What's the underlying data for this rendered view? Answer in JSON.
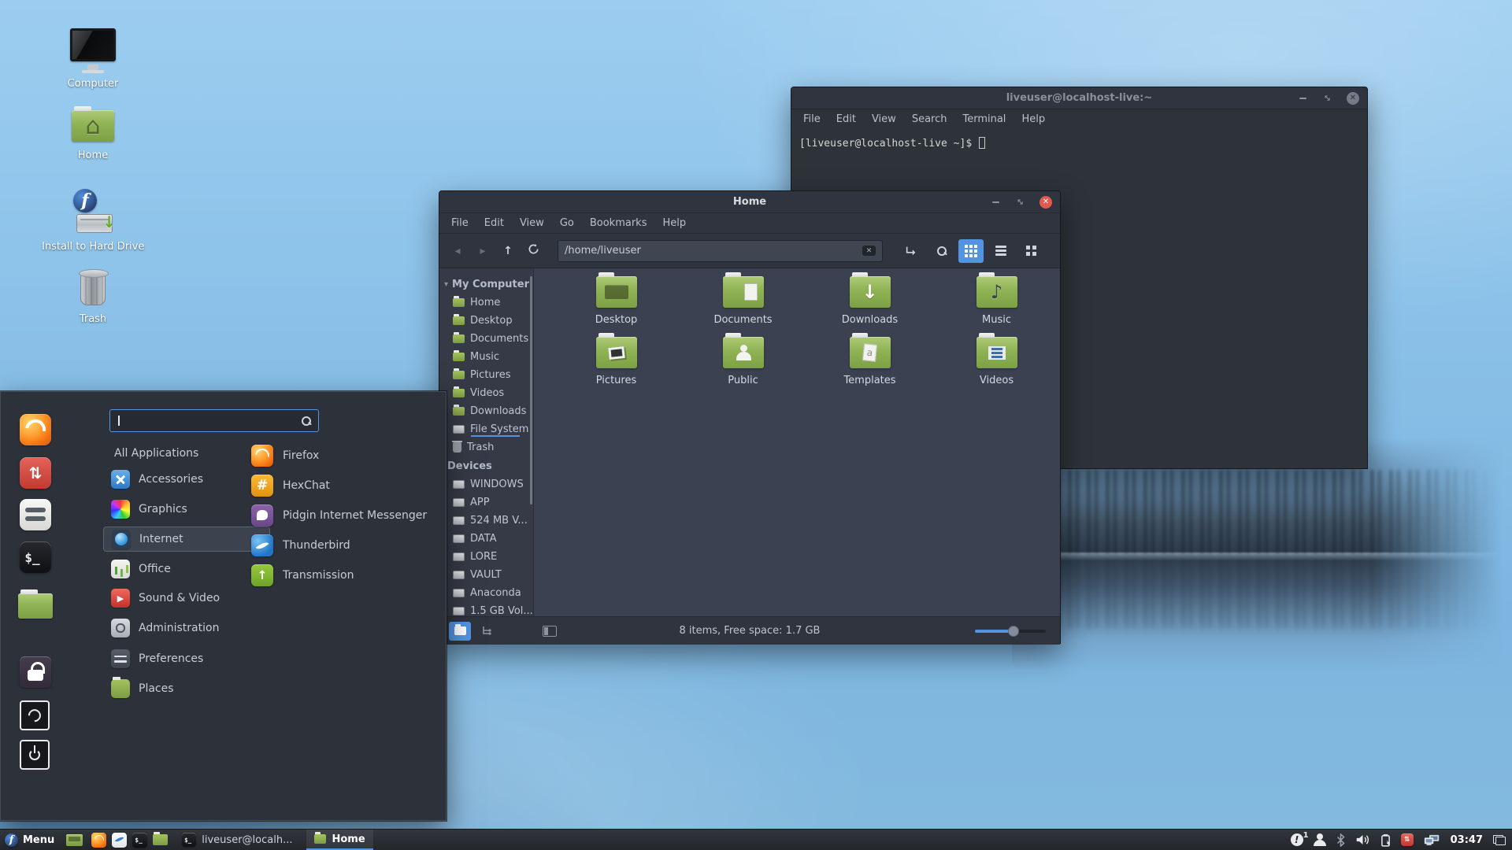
{
  "desktop": {
    "icons": [
      {
        "label": "Computer"
      },
      {
        "label": "Home"
      },
      {
        "label": "Install to Hard Drive"
      },
      {
        "label": "Trash"
      }
    ]
  },
  "terminal": {
    "title": "liveuser@localhost-live:~",
    "menu": [
      "File",
      "Edit",
      "View",
      "Search",
      "Terminal",
      "Help"
    ],
    "prompt": "[liveuser@localhost-live ~]$"
  },
  "filemanager": {
    "title": "Home",
    "menu": [
      "File",
      "Edit",
      "View",
      "Go",
      "Bookmarks",
      "Help"
    ],
    "path": "/home/liveuser",
    "sidebar": {
      "computer_header": "My Computer",
      "computer_items": [
        "Home",
        "Desktop",
        "Documents",
        "Music",
        "Pictures",
        "Videos",
        "Downloads",
        "File System",
        "Trash"
      ],
      "devices_header": "Devices",
      "devices_items": [
        "WINDOWS",
        "APP",
        "524 MB V...",
        "DATA",
        "LORE",
        "VAULT",
        "Anaconda",
        "1.5 GB Vol..."
      ]
    },
    "folders": [
      "Desktop",
      "Documents",
      "Downloads",
      "Music",
      "Pictures",
      "Public",
      "Templates",
      "Videos"
    ],
    "statusbar": {
      "text": "8 items, Free space: 1.7 GB"
    }
  },
  "menu": {
    "search_value": "",
    "categories": [
      "All Applications",
      "Accessories",
      "Graphics",
      "Internet",
      "Office",
      "Sound & Video",
      "Administration",
      "Preferences",
      "Places"
    ],
    "selected_category": "Internet",
    "apps": [
      "Firefox",
      "HexChat",
      "Pidgin Internet Messenger",
      "Thunderbird",
      "Transmission"
    ],
    "favorites": [
      "firefox",
      "software-updater",
      "system-settings",
      "terminal",
      "files"
    ],
    "session": [
      "lock-screen",
      "logout",
      "shutdown"
    ]
  },
  "taskbar": {
    "menu_label": "Menu",
    "launchers": [
      "show-desktop",
      "firefox",
      "text-editor",
      "terminal",
      "files"
    ],
    "windows": [
      {
        "icon": "terminal",
        "label": "liveuser@localh...",
        "active": false
      },
      {
        "icon": "files",
        "label": "Home",
        "active": true
      }
    ],
    "tray": [
      "notifications",
      "user",
      "bluetooth",
      "volume",
      "battery",
      "updates",
      "network",
      "clock",
      "window-switcher"
    ],
    "notification_count": "1",
    "clock": "03:47"
  },
  "colors": {
    "accent": "#5294e2",
    "close_button": "#e25a4e",
    "folder_green": "#8fb254",
    "terminal_bg": "#2d3339"
  }
}
